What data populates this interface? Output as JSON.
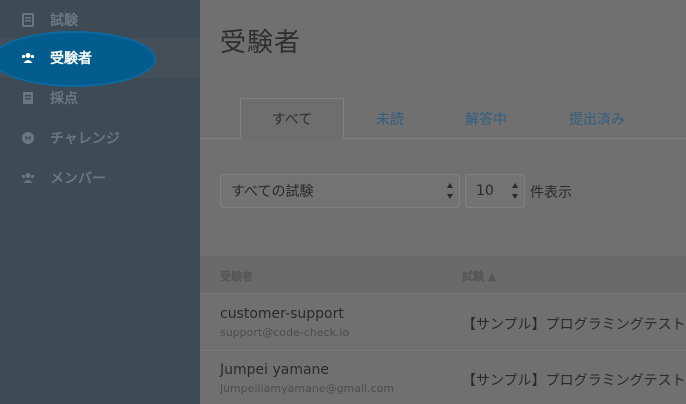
{
  "sidebar": {
    "items": [
      {
        "label": "試験",
        "icon": "exam-icon",
        "active": false
      },
      {
        "label": "受験者",
        "icon": "users-icon",
        "active": true
      },
      {
        "label": "採点",
        "icon": "grading-icon",
        "active": false
      },
      {
        "label": "チャレンジ",
        "icon": "challenge-icon",
        "active": false
      },
      {
        "label": "メンバー",
        "icon": "members-icon",
        "active": false
      }
    ]
  },
  "main": {
    "title": "受験者",
    "tabs": [
      {
        "label": "すべて",
        "active": true
      },
      {
        "label": "未読",
        "active": false
      },
      {
        "label": "解答中",
        "active": false
      },
      {
        "label": "提出済み",
        "active": false
      }
    ],
    "filters": {
      "exam_select": "すべての試験",
      "per_page_select": "10",
      "per_page_label": "件表示"
    },
    "table": {
      "headers": {
        "candidate": "受験者",
        "exam": "試験 ▲"
      },
      "rows": [
        {
          "name": "customer-support",
          "email": "support@code-check.io",
          "exam": "【サンプル】プログラミングテスト"
        },
        {
          "name": "Jumpei yamane",
          "email": "jumpeiliamyamane@gmail.com",
          "exam": "【サンプル】プログラミングテスト"
        }
      ]
    }
  },
  "colors": {
    "sidebar_bg": "#3f4b54",
    "highlight": "#025d8e",
    "tab_link": "#2f5f82"
  }
}
